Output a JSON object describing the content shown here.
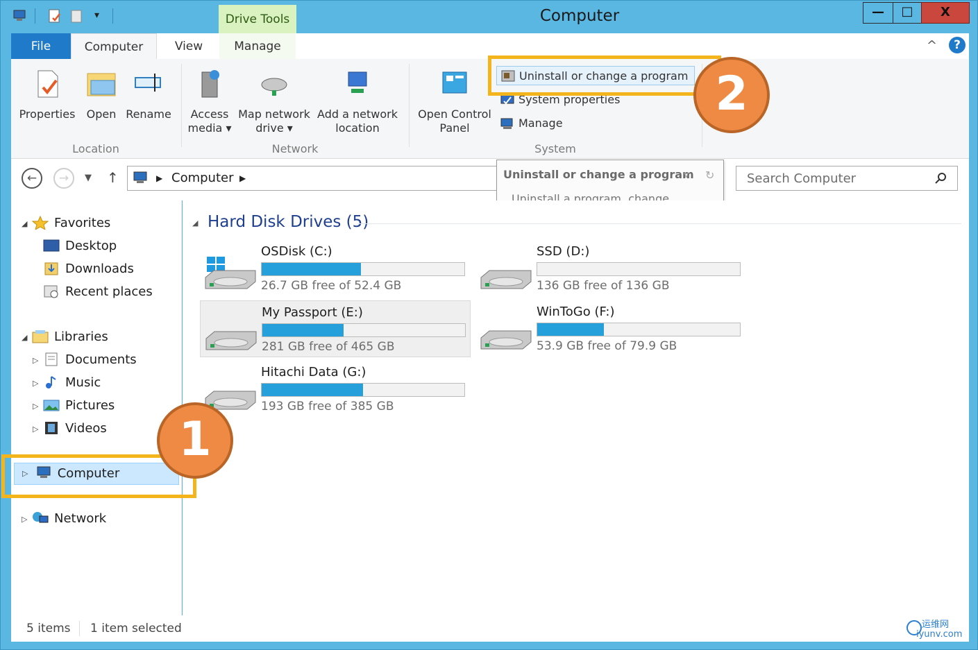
{
  "window": {
    "title": "Computer",
    "context_tab": "Drive Tools",
    "minimize": "—",
    "maximize": "□",
    "close": "X"
  },
  "tabs": {
    "file": "File",
    "computer": "Computer",
    "view": "View",
    "manage": "Manage"
  },
  "ribbon": {
    "properties": "Properties",
    "open": "Open",
    "rename": "Rename",
    "access_media_l1": "Access",
    "access_media_l2": "media ▾",
    "map_drive_l1": "Map network",
    "map_drive_l2": "drive ▾",
    "add_location_l1": "Add a network",
    "add_location_l2": "location",
    "open_cp_l1": "Open Control",
    "open_cp_l2": "Panel",
    "uninstall": "Uninstall or change a program",
    "system_properties": "System properties",
    "manage": "Manage",
    "group_location": "Location",
    "group_network": "Network",
    "group_system": "System"
  },
  "address": {
    "path": "Computer",
    "search_placeholder": "Search Computer"
  },
  "tooltip": {
    "title": "Uninstall or change a program",
    "body": "Uninstall a program, change installed features, or repair an installation."
  },
  "nav": {
    "favorites": "Favorites",
    "desktop": "Desktop",
    "downloads": "Downloads",
    "recent": "Recent places",
    "libraries": "Libraries",
    "documents": "Documents",
    "music": "Music",
    "pictures": "Pictures",
    "videos": "Videos",
    "computer": "Computer",
    "network": "Network"
  },
  "content": {
    "section_title": "Hard Disk Drives (5)",
    "drives": [
      {
        "name": "OSDisk (C:)",
        "free": "26.7 GB free of 52.4 GB",
        "used_fraction": 0.49
      },
      {
        "name": "SSD (D:)",
        "free": "136 GB free of 136 GB",
        "used_fraction": 0.0
      },
      {
        "name": "My Passport (E:)",
        "free": "281 GB free of 465 GB",
        "used_fraction": 0.4
      },
      {
        "name": "WinToGo (F:)",
        "free": "53.9 GB free of 79.9 GB",
        "used_fraction": 0.33
      },
      {
        "name": "Hitachi Data (G:)",
        "free": "193 GB free of 385 GB",
        "used_fraction": 0.5
      }
    ]
  },
  "status": {
    "items": "5 items",
    "selected": "1 item selected"
  },
  "annotations": {
    "badge1": "1",
    "badge2": "2",
    "highlight_color": "#f3b51b",
    "badge_color": "#ee8a43"
  },
  "watermark": {
    "line1": "运维网",
    "line2": "iyunv.com"
  },
  "colors": {
    "title_bar": "#5ab7e2",
    "file_tab": "#1f7ac9",
    "drive_bar": "#26a0da",
    "section_title": "#1e3f8f"
  }
}
